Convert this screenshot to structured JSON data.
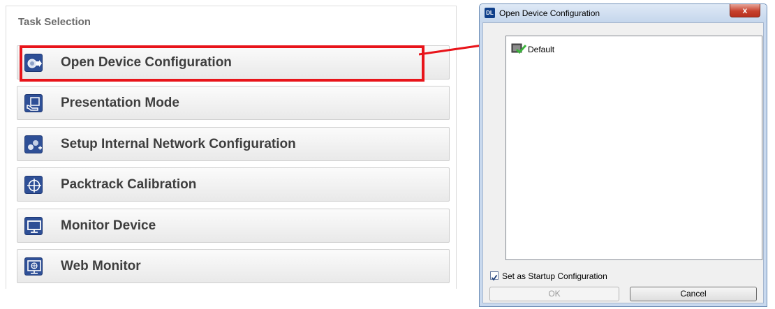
{
  "task_panel": {
    "title": "Task Selection",
    "items": [
      {
        "label": "Open Device Configuration",
        "icon": "open-device-icon"
      },
      {
        "label": "Presentation Mode",
        "icon": "presentation-icon"
      },
      {
        "label": "Setup Internal Network Configuration",
        "icon": "network-config-icon"
      },
      {
        "label": "Packtrack Calibration",
        "icon": "crosshair-icon"
      },
      {
        "label": "Monitor Device",
        "icon": "monitor-icon"
      },
      {
        "label": "Web Monitor",
        "icon": "web-monitor-icon"
      }
    ],
    "highlight_color": "#e8141a"
  },
  "dialog": {
    "app_icon_text": "DL",
    "title": "Open Device Configuration",
    "close_glyph": "x",
    "list_items": [
      {
        "label": "Default",
        "icon": "config-check-icon"
      }
    ],
    "startup_checkbox": {
      "label": "Set as Startup Configuration",
      "checked": true
    },
    "ok_label": "OK",
    "cancel_label": "Cancel"
  },
  "colors": {
    "icon_blue": "#2e4f96",
    "arrow_red": "#e8141a"
  }
}
